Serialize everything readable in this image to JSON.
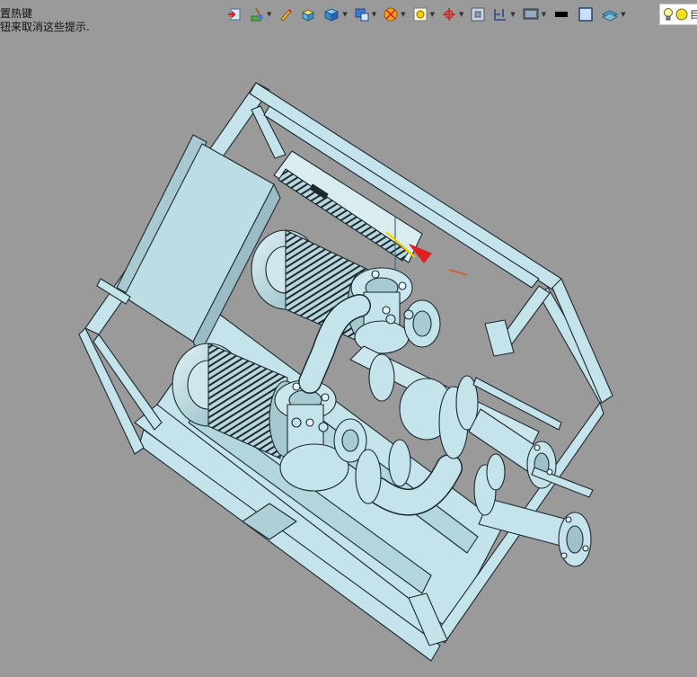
{
  "hint": {
    "line1": "置热键",
    "line2": "钮来取消这些提示."
  },
  "toolbar": {
    "buttons": [
      {
        "id": "exit",
        "icon": "exit-sketch-icon"
      },
      {
        "id": "paint",
        "icon": "paint-brush-icon",
        "dropdown": true
      },
      {
        "id": "pencil",
        "icon": "pencil-icon"
      },
      {
        "id": "box",
        "icon": "box-icon"
      },
      {
        "id": "cube",
        "icon": "blue-cube-icon",
        "dropdown": true
      },
      {
        "id": "view",
        "icon": "view-orientation-icon",
        "dropdown": true
      },
      {
        "id": "section",
        "icon": "section-view-icon",
        "dropdown": true
      },
      {
        "id": "zoom",
        "icon": "zoom-window-icon",
        "dropdown": true
      },
      {
        "id": "origin",
        "icon": "coordinate-icon",
        "dropdown": true
      },
      {
        "id": "frame",
        "icon": "frame-icon"
      },
      {
        "id": "measure",
        "icon": "measure-icon",
        "dropdown": true
      },
      {
        "id": "display",
        "icon": "display-mode-icon",
        "dropdown": true
      },
      {
        "id": "black",
        "icon": "black-rect-icon"
      },
      {
        "id": "blue",
        "icon": "blue-square-icon"
      },
      {
        "id": "layers",
        "icon": "layers-icon",
        "dropdown": true
      }
    ],
    "light_label": "目"
  },
  "colors": {
    "background": "#9a9a9a",
    "part_fill": "#c4e3ea",
    "part_edge": "#1d2a30",
    "accent_red": "#e02020",
    "accent_yellow": "#f2d000"
  }
}
